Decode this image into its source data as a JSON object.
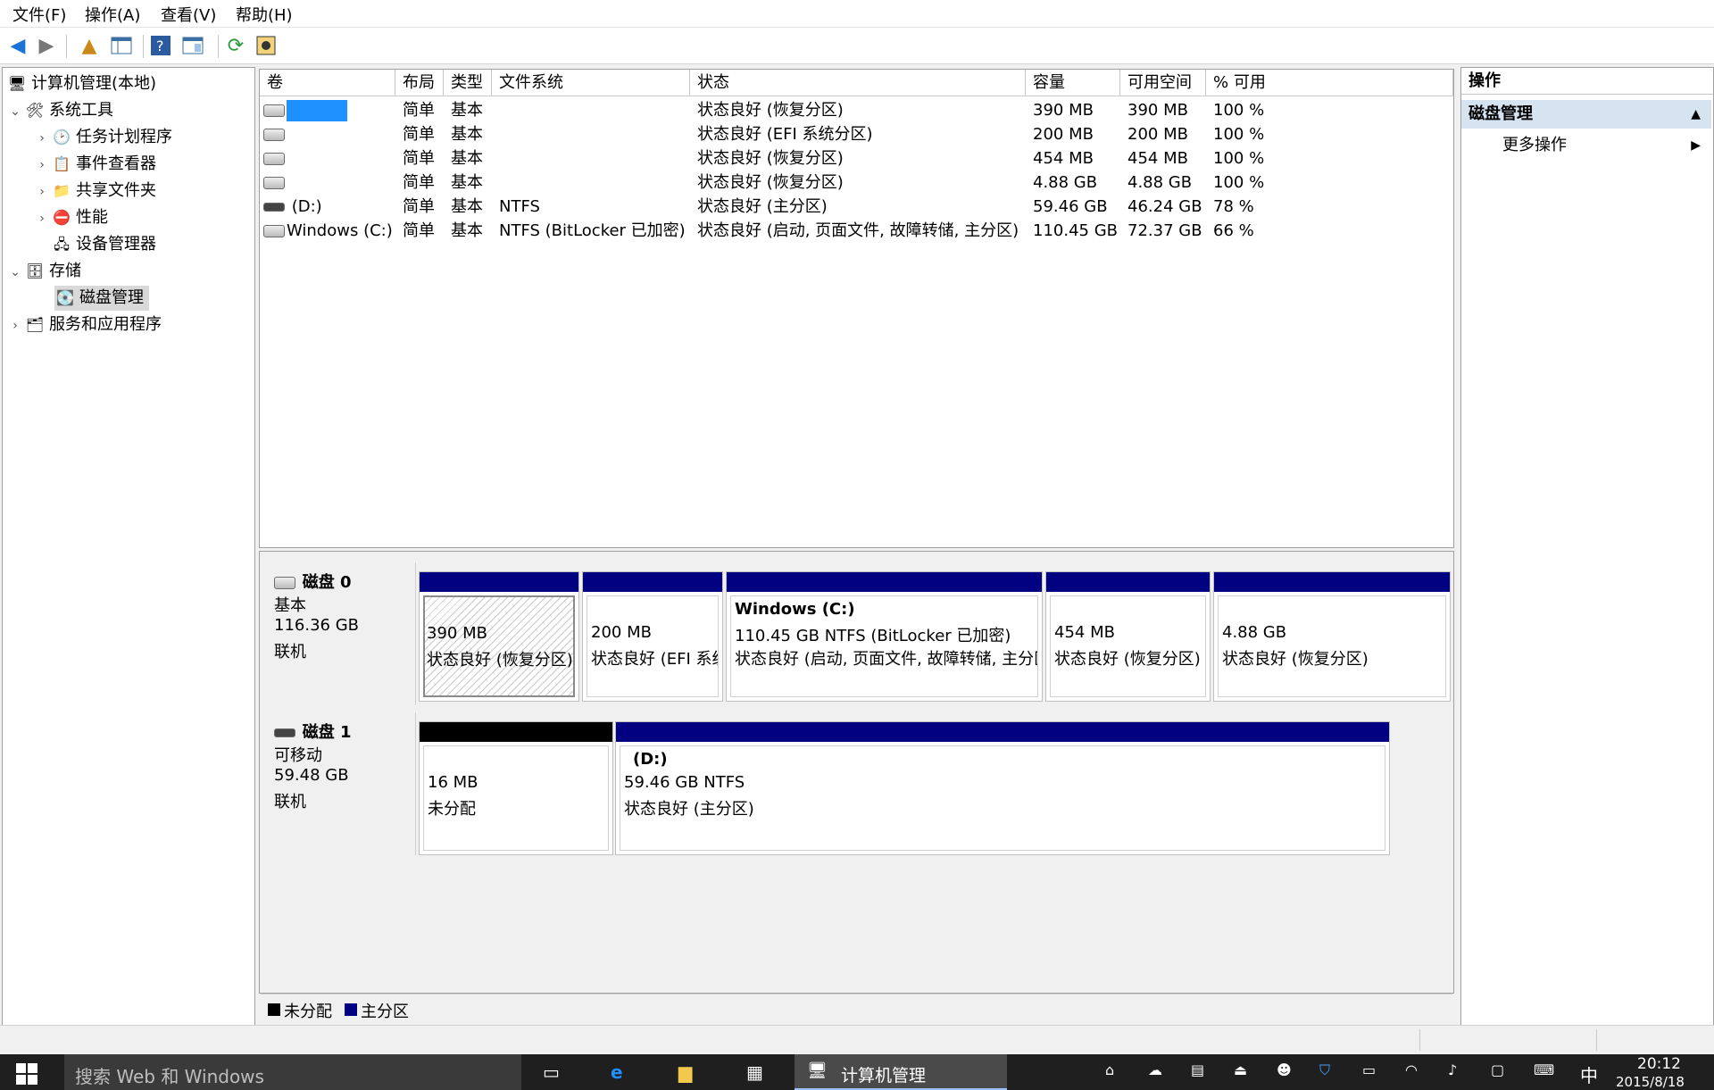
{
  "menu": [
    "文件(F)",
    "操作(A)",
    "查看(V)",
    "帮助(H)"
  ],
  "tree": {
    "root": "计算机管理(本地)",
    "system_tools": "系统工具",
    "task_scheduler": "任务计划程序",
    "event_viewer": "事件查看器",
    "shared_folders": "共享文件夹",
    "performance": "性能",
    "device_manager": "设备管理器",
    "storage": "存储",
    "disk_management": "磁盘管理",
    "services_apps": "服务和应用程序"
  },
  "columns": [
    "卷",
    "布局",
    "类型",
    "文件系统",
    "状态",
    "容量",
    "可用空间",
    "% 可用"
  ],
  "volumes": [
    {
      "name": "",
      "layout": "简单",
      "type": "基本",
      "fs": "",
      "status": "状态良好 (恢复分区)",
      "capacity": "390 MB",
      "free": "390 MB",
      "pct": "100 %"
    },
    {
      "name": "",
      "layout": "简单",
      "type": "基本",
      "fs": "",
      "status": "状态良好 (EFI 系统分区)",
      "capacity": "200 MB",
      "free": "200 MB",
      "pct": "100 %"
    },
    {
      "name": "",
      "layout": "简单",
      "type": "基本",
      "fs": "",
      "status": "状态良好 (恢复分区)",
      "capacity": "454 MB",
      "free": "454 MB",
      "pct": "100 %"
    },
    {
      "name": "",
      "layout": "简单",
      "type": "基本",
      "fs": "",
      "status": "状态良好 (恢复分区)",
      "capacity": "4.88 GB",
      "free": "4.88 GB",
      "pct": "100 %"
    },
    {
      "name": "(D:)",
      "layout": "简单",
      "type": "基本",
      "fs": "NTFS",
      "status": "状态良好 (主分区)",
      "capacity": "59.46 GB",
      "free": "46.24 GB",
      "pct": "78 %"
    },
    {
      "name": "Windows (C:)",
      "layout": "简单",
      "type": "基本",
      "fs": "NTFS (BitLocker 已加密)",
      "status": "状态良好 (启动, 页面文件, 故障转储, 主分区)",
      "capacity": "110.45 GB",
      "free": "72.37 GB",
      "pct": "66 %"
    }
  ],
  "disk0": {
    "name": "磁盘 0",
    "kind": "基本",
    "size": "116.36 GB",
    "state": "联机",
    "parts": [
      {
        "title": "",
        "l1": "390 MB",
        "l2": "状态良好 (恢复分区)"
      },
      {
        "title": "",
        "l1": "200 MB",
        "l2": "状态良好 (EFI 系统分区)"
      },
      {
        "title": "Windows  (C:)",
        "l1": "110.45 GB NTFS (BitLocker 已加密)",
        "l2": "状态良好 (启动, 页面文件, 故障转储, 主分区)"
      },
      {
        "title": "",
        "l1": "454 MB",
        "l2": "状态良好 (恢复分区)"
      },
      {
        "title": "",
        "l1": "4.88 GB",
        "l2": "状态良好 (恢复分区)"
      }
    ]
  },
  "disk1": {
    "name": "磁盘 1",
    "kind": "可移动",
    "size": "59.48 GB",
    "state": "联机",
    "parts": [
      {
        "title": "",
        "l1": "16 MB",
        "l2": "未分配"
      },
      {
        "title": "(D:)",
        "l1": "59.46 GB NTFS",
        "l2": "状态良好 (主分区)"
      }
    ]
  },
  "legend": {
    "unallocated": "未分配",
    "primary": "主分区"
  },
  "actions": {
    "header": "操作",
    "section": "磁盘管理",
    "more": "更多操作"
  },
  "taskbar": {
    "search_placeholder": "搜索 Web 和 Windows",
    "app": "计算机管理",
    "ime": "中",
    "time": "20:12",
    "date": "2015/8/18"
  },
  "colors": {
    "primary": "#000080",
    "unallocated": "#000000",
    "selection": "#1e90ff"
  }
}
